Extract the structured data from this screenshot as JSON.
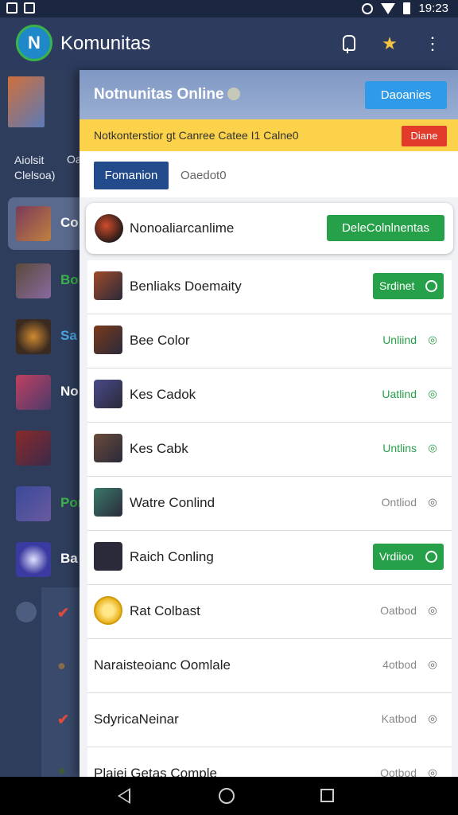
{
  "status_bar": {
    "time": "19:23"
  },
  "app_bar": {
    "title": "Komunitas",
    "logo_text": "N"
  },
  "left_list": {
    "caption_line1": "Aiolsit",
    "caption_line2": "Clelsoa)",
    "caption_side": "Oa",
    "items": [
      {
        "label": "Co",
        "color": "#ffffff"
      },
      {
        "label": "Bon",
        "color": "#3ab34a"
      },
      {
        "label": "Sa",
        "color": "#49a3e0"
      },
      {
        "label": "No",
        "color": "#ffffff"
      },
      {
        "label": "",
        "color": "#ffffff"
      },
      {
        "label": "Por",
        "color": "#3ab34a"
      },
      {
        "label": "Ba",
        "color": "#ffffff"
      }
    ]
  },
  "sheet": {
    "title": "Notnunitas Online",
    "header_button": "Daoanies",
    "notice_text": "Notkonterstior gt Canree Catee I1 Calne0",
    "notice_button": "Diane",
    "tab_active": "Fomanion",
    "tab_inactive": "Oaedot0",
    "featured": {
      "name": "Nonoaliarcanlime",
      "button": "DeleColnlnentas"
    },
    "rows": [
      {
        "name": "Benliaks Doemaity",
        "type": "button",
        "button": "Srdinet",
        "thumb": "#a04a2a"
      },
      {
        "name": "Bee Color",
        "type": "status",
        "status": "Unliind",
        "status_color": "green",
        "thumb": "#7a3a1a"
      },
      {
        "name": "Kes Cadok",
        "type": "status",
        "status": "Uatlind",
        "status_color": "green",
        "thumb": "#4a4a8a"
      },
      {
        "name": "Kes Cabk",
        "type": "status",
        "status": "Untlins",
        "status_color": "green",
        "thumb": "#6a4a3a"
      },
      {
        "name": "Watre Conlind",
        "type": "status",
        "status": "Ontliod",
        "status_color": "grey",
        "thumb": "#3a7a6a"
      },
      {
        "name": "Raich Conling",
        "type": "button",
        "button": "Vrdiioo",
        "thumb": "#2a2a3a"
      },
      {
        "name": "Rat Colbast",
        "type": "status",
        "status": "Oatbod",
        "status_color": "grey",
        "thumb": "coin"
      },
      {
        "name": "Naraisteoianc Oomlale",
        "type": "status",
        "status": "4otbod",
        "status_color": "grey",
        "thumb": ""
      },
      {
        "name": "SdyricaNeinar",
        "type": "status",
        "status": "Katbod",
        "status_color": "grey",
        "thumb": ""
      },
      {
        "name": "Plaiei Getas Comple",
        "type": "status",
        "status": "Ootbod",
        "status_color": "grey",
        "thumb": ""
      }
    ]
  }
}
